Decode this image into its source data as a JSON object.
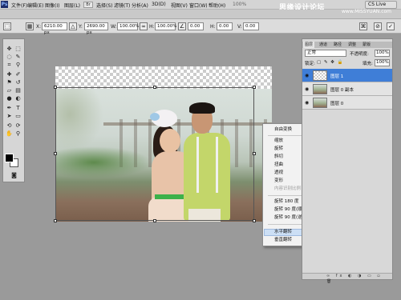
{
  "app": {
    "logo": "Ps"
  },
  "menu": {
    "items": [
      "文件(F)",
      "编辑(E)",
      "图像(I)",
      "图层(L)",
      "选择(S)",
      "滤镜(T)",
      "分析(A)",
      "3D(D)",
      "视图(V)",
      "窗口(W)",
      "帮助(H)"
    ],
    "zoom": "100%"
  },
  "watermark": {
    "text": "思缘设计论坛",
    "url": "www.MISSYUAN.com"
  },
  "cslive": {
    "label": "CS Live"
  },
  "options": {
    "x_label": "X:",
    "x_value": "6210.00 px",
    "y_label": "Y:",
    "y_value": "2690.00 px",
    "w_label": "W:",
    "w_value": "100.00%",
    "h_label": "H:",
    "h_value": "100.00%",
    "angle_value": "0.00",
    "hskew_label": "H:",
    "hskew_value": "0.00",
    "vskew_label": "V:",
    "vskew_value": "0.00"
  },
  "context_menu": {
    "items": [
      {
        "label": "自由变换",
        "disabled": false
      },
      {
        "label": "缩放",
        "disabled": false
      },
      {
        "label": "旋转",
        "disabled": false
      },
      {
        "label": "斜切",
        "disabled": false
      },
      {
        "label": "扭曲",
        "disabled": false
      },
      {
        "label": "透视",
        "disabled": false
      },
      {
        "label": "变形",
        "disabled": false
      },
      {
        "label": "内容识别比例",
        "disabled": true
      },
      {
        "label": "旋转 180 度",
        "disabled": false
      },
      {
        "label": "旋转 90 度(顺时针)",
        "disabled": false
      },
      {
        "label": "旋转 90 度(逆时针)",
        "disabled": false
      },
      {
        "label": "水平翻转",
        "disabled": false
      },
      {
        "label": "垂直翻转",
        "disabled": false
      }
    ],
    "highlighted": "水平翻转"
  },
  "layers_panel": {
    "tabs": [
      "图层",
      "通道",
      "路径",
      "调整",
      "蒙版"
    ],
    "blend_mode": "正常",
    "opacity_label": "不透明度:",
    "opacity_value": "100%",
    "lock_label": "锁定:",
    "fill_label": "填充:",
    "fill_value": "100%",
    "layers": [
      {
        "name": "图层 1",
        "active": true,
        "thumb": "transparent"
      },
      {
        "name": "图层 0 副本",
        "active": false,
        "thumb": "photo"
      },
      {
        "name": "图层 0",
        "active": false,
        "thumb": "photo"
      }
    ],
    "footer_icons": "∞ fx ◐ ◑ ▭ ▫ 🗑"
  }
}
